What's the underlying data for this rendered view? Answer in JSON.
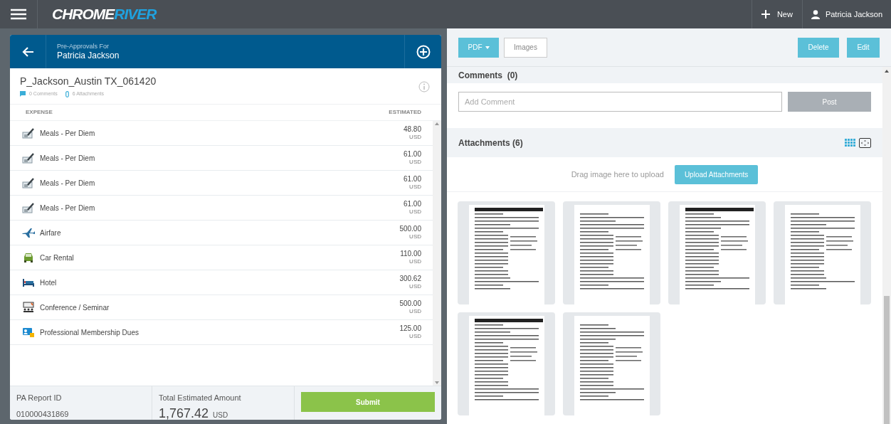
{
  "top_bar": {
    "logo": [
      "CHROME",
      "RIVER"
    ],
    "new_label": "New",
    "user_name": "Patricia Jackson"
  },
  "left_panel": {
    "header": {
      "subtitle": "Pre-Approvals For",
      "title": "Patricia Jackson"
    },
    "report_name": "P_Jackson_Austin TX_061420",
    "comments_count": "0 Comments",
    "attachments_count": "6 Attachments",
    "table": {
      "columns": [
        "EXPENSE",
        "ESTIMATED"
      ],
      "rows": [
        {
          "kind": "meals",
          "name": "Meals - Per Diem",
          "amount": "48.80",
          "currency": "USD"
        },
        {
          "kind": "meals",
          "name": "Meals - Per Diem",
          "amount": "61.00",
          "currency": "USD"
        },
        {
          "kind": "meals",
          "name": "Meals - Per Diem",
          "amount": "61.00",
          "currency": "USD"
        },
        {
          "kind": "meals",
          "name": "Meals - Per Diem",
          "amount": "61.00",
          "currency": "USD"
        },
        {
          "kind": "airfare",
          "name": "Airfare",
          "amount": "500.00",
          "currency": "USD"
        },
        {
          "kind": "car",
          "name": "Car Rental",
          "amount": "110.00",
          "currency": "USD"
        },
        {
          "kind": "hotel",
          "name": "Hotel",
          "amount": "300.62",
          "currency": "USD"
        },
        {
          "kind": "conference",
          "name": "Conference / Seminar",
          "amount": "500.00",
          "currency": "USD"
        },
        {
          "kind": "membership",
          "name": "Professional Membership Dues",
          "amount": "125.00",
          "currency": "USD"
        }
      ]
    },
    "footer": {
      "id_label": "PA Report ID",
      "id_value": "010000431869",
      "total_label": "Total Estimated Amount",
      "total_value": "1,767.42",
      "total_currency": "USD",
      "submit": "Submit"
    }
  },
  "right_panel": {
    "toolbar": {
      "pdf": "PDF",
      "images": "Images",
      "delete": "Delete",
      "edit": "Edit"
    },
    "comments": {
      "title": "Comments  (0)",
      "placeholder": "Add Comment",
      "post": "Post",
      "post_disabled": true
    },
    "attachments": {
      "title": "Attachments (6)",
      "hint": "Drag image here to upload",
      "upload": "Upload Attachments"
    }
  }
}
